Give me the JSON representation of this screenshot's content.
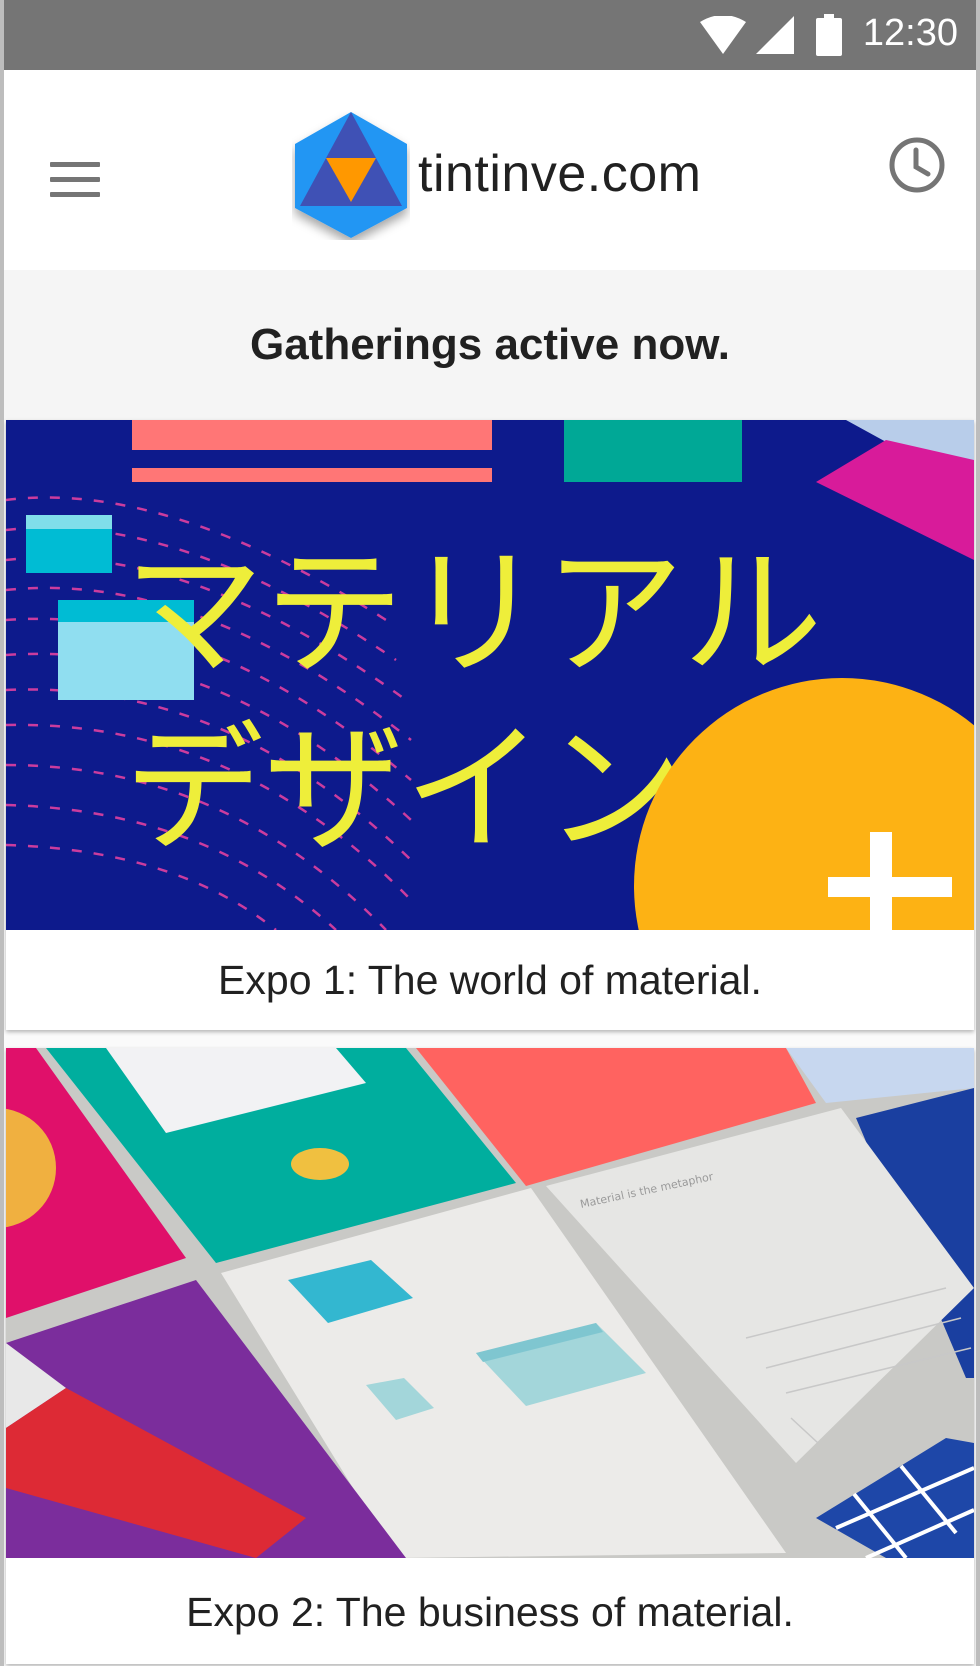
{
  "status_bar": {
    "time": "12:30",
    "icons": [
      "wifi-icon",
      "signal-icon",
      "battery-icon"
    ]
  },
  "app_bar": {
    "menu_icon": "menu-icon",
    "logo_icon": "hexagon-logo-icon",
    "site_name": "tintinve.com",
    "history_icon": "history-clock-icon"
  },
  "section": {
    "heading": "Gatherings active now."
  },
  "cards": [
    {
      "image": "material-design-japanese-poster-image",
      "image_text": "マテリアルデザイン",
      "title": "Expo 1: The world of material."
    },
    {
      "image": "material-design-paper-sheets-image",
      "image_text": "Material is the metaphor",
      "title": "Expo 2: The business of material."
    }
  ],
  "colors": {
    "status_bar": "#757575",
    "app_bar": "#ffffff",
    "subheader": "#f5f5f5",
    "text": "#212121",
    "icon_gray": "#757575",
    "logo_blue": "#2196f3",
    "logo_indigo": "#3f51b5",
    "logo_orange": "#ff9800"
  }
}
